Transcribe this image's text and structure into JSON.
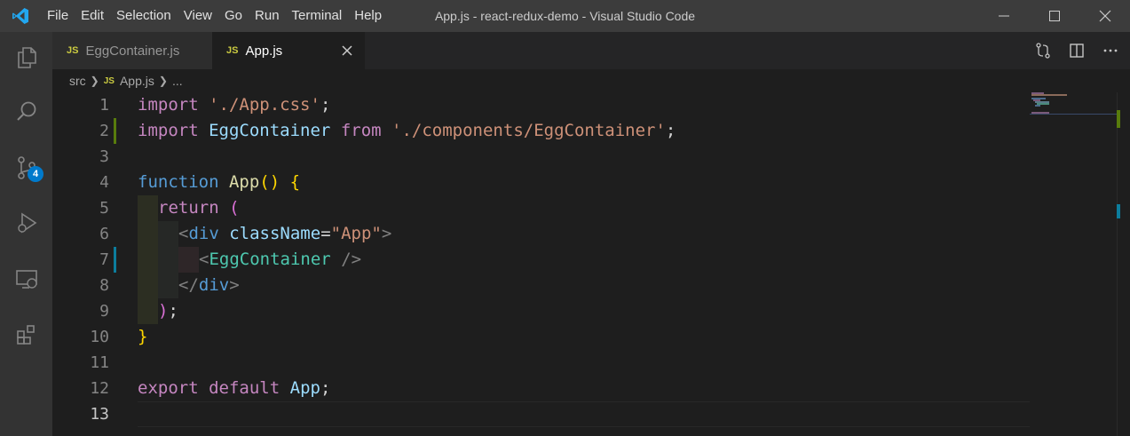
{
  "titlebar": {
    "menu": [
      "File",
      "Edit",
      "Selection",
      "View",
      "Go",
      "Run",
      "Terminal",
      "Help"
    ],
    "title": "App.js - react-redux-demo - Visual Studio Code"
  },
  "activity": {
    "items": [
      "explorer-icon",
      "search-icon",
      "source-control-icon",
      "run-debug-icon",
      "remote-explorer-icon",
      "extensions-icon"
    ],
    "scm_badge": "4"
  },
  "tabs": [
    {
      "icon": "JS",
      "label": "EggContainer.js",
      "active": false
    },
    {
      "icon": "JS",
      "label": "App.js",
      "active": true
    }
  ],
  "breadcrumb": {
    "folder": "src",
    "file_icon": "JS",
    "file": "App.js",
    "more": "..."
  },
  "editor": {
    "line_numbers": [
      "1",
      "2",
      "3",
      "4",
      "5",
      "6",
      "7",
      "8",
      "9",
      "10",
      "11",
      "12",
      "13"
    ],
    "tokens": {
      "l1": [
        "import",
        " ",
        "'./App.css'",
        ";"
      ],
      "l2": [
        "import",
        " ",
        "EggContainer",
        " ",
        "from",
        " ",
        "'./components/EggContainer'",
        ";"
      ],
      "l4": [
        "function",
        " ",
        "App",
        "()",
        " ",
        "{"
      ],
      "l5": [
        "return",
        " ",
        "("
      ],
      "l6": [
        "<",
        "div",
        " ",
        "className",
        "=",
        "\"App\"",
        ">"
      ],
      "l7": [
        "<",
        "EggContainer",
        " ",
        "/>"
      ],
      "l8": [
        "</",
        "div",
        ">"
      ],
      "l9": [
        ")",
        ";"
      ],
      "l10": [
        "}"
      ],
      "l12": [
        "export",
        " ",
        "default",
        " ",
        "App",
        ";"
      ]
    }
  },
  "colors": {
    "keyword": "#c586c0",
    "string": "#ce9178",
    "function": "#dcdcaa",
    "variable": "#9cdcfe",
    "storage": "#569cd6",
    "component": "#4ec9b0",
    "accent": "#007acc"
  }
}
